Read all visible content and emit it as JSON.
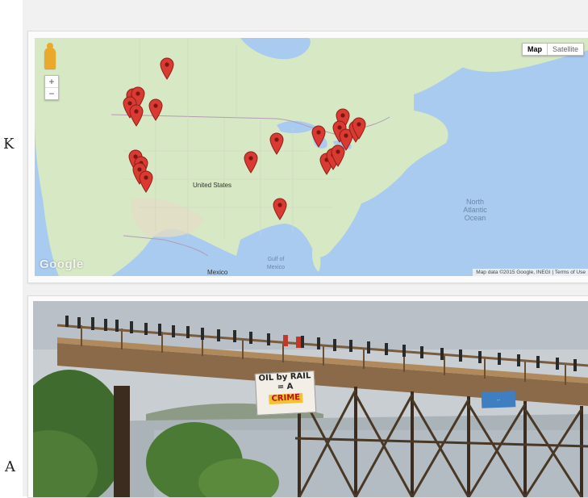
{
  "colors": {
    "page_bg": "#f1f1f1",
    "water": "#a9cbef",
    "land": "#d7e8c4",
    "pin": "#d93a32"
  },
  "map": {
    "map_type": {
      "map_label": "Map",
      "satellite_label": "Satellite"
    },
    "zoom": {
      "in_label": "+",
      "out_label": "−"
    },
    "country_label": "United States",
    "mexico_label": "Mexico",
    "gulf_label": "Gulf of Mexico",
    "ocean_label": "North Atlantic Ocean",
    "logo_text": "Google",
    "attribution": "Map data ©2015 Google, INEGI",
    "terms_label": "Terms of Use",
    "marker_count": 22
  },
  "photo": {
    "banner_line1": "OIL by RAIL",
    "banner_line2": "= A",
    "banner_line3": "CRIME",
    "sign_text": "..."
  },
  "edge_text": {
    "top": "K",
    "bottom": "A"
  }
}
